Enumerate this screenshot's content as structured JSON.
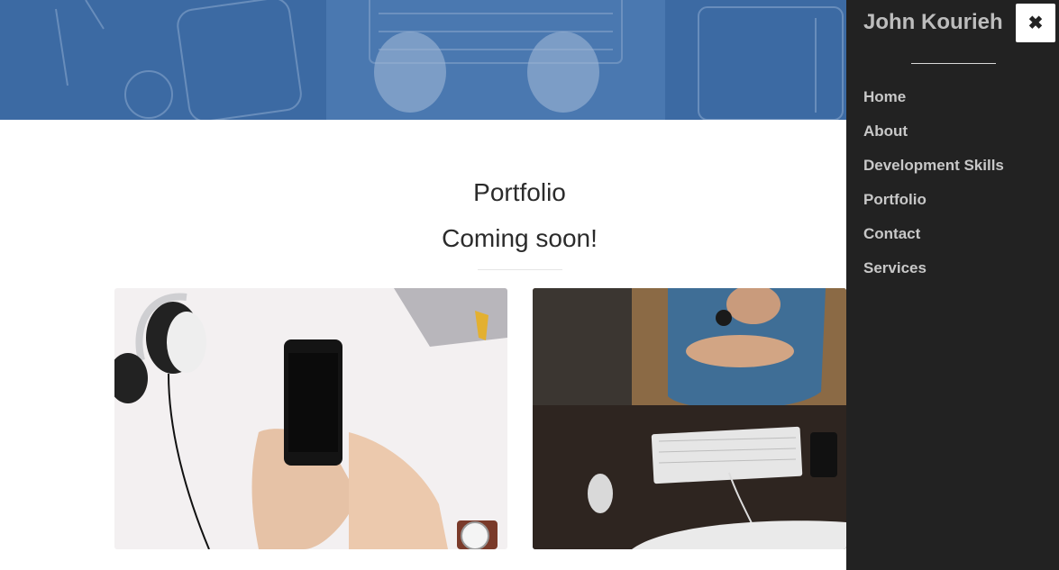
{
  "hero": {
    "image_description": "desk with laptop, tablet, notebook"
  },
  "portfolio": {
    "title": "Portfolio",
    "subtitle": "Coming soon!"
  },
  "cards": [
    {
      "alt": "hands holding smartphone with headphones"
    },
    {
      "alt": "person at desk with keyboard"
    }
  ],
  "sidemenu": {
    "brand": "John Kourieh",
    "close_symbol": "✖",
    "items": [
      {
        "label": "Home"
      },
      {
        "label": "About"
      },
      {
        "label": "Development Skills"
      },
      {
        "label": "Portfolio"
      },
      {
        "label": "Contact"
      },
      {
        "label": "Services"
      }
    ]
  },
  "colors": {
    "hero_blue": "#3c6aa3",
    "sidemenu_bg": "#222222",
    "menu_text": "#c8c8c8"
  }
}
